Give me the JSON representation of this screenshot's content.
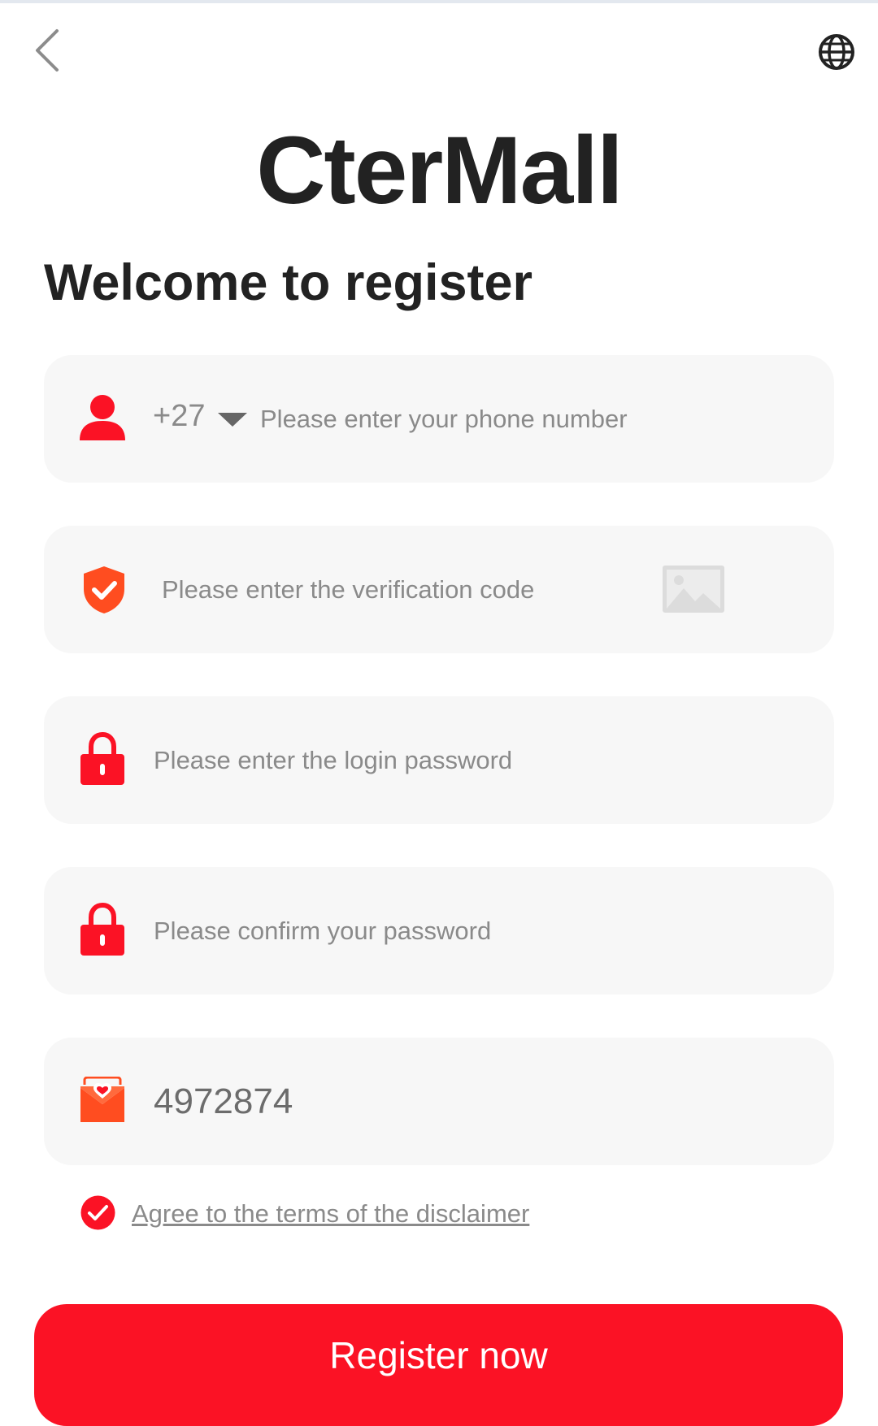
{
  "header": {
    "back_icon": "chevron-left-icon",
    "language_icon": "globe-icon"
  },
  "brand": {
    "name": "CterMall"
  },
  "page": {
    "heading": "Welcome to register"
  },
  "form": {
    "phone": {
      "country_code": "+27",
      "placeholder": "Please enter your phone number",
      "icon": "user-icon"
    },
    "verification": {
      "placeholder": "Please enter the verification code",
      "icon": "shield-check-icon",
      "captcha_icon": "image-placeholder-icon"
    },
    "password": {
      "placeholder": "Please enter the login password",
      "icon": "lock-icon"
    },
    "confirm_password": {
      "placeholder": "Please confirm your password",
      "icon": "lock-icon"
    },
    "invite_code": {
      "value": "4972874",
      "icon": "envelope-heart-icon"
    }
  },
  "agreement": {
    "label": "Agree to the terms of the disclaimer",
    "checked": true
  },
  "actions": {
    "register_label": "Register now"
  },
  "colors": {
    "accent": "#fb1225",
    "field_bg": "#f7f7f7",
    "text_dark": "#222222",
    "placeholder": "#8a8a8a",
    "shield": "#ff4d20"
  }
}
